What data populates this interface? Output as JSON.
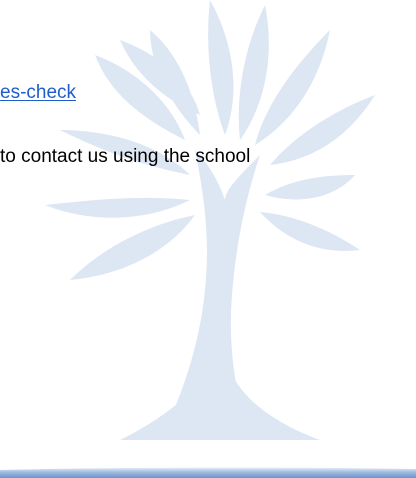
{
  "document": {
    "link_fragment": "es-check",
    "body_fragment": "to contact us using the school"
  },
  "watermark": {
    "icon": "tree-watermark-icon",
    "color": "#dce6f3"
  },
  "footer": {
    "band_color": "#8fb0dc"
  }
}
